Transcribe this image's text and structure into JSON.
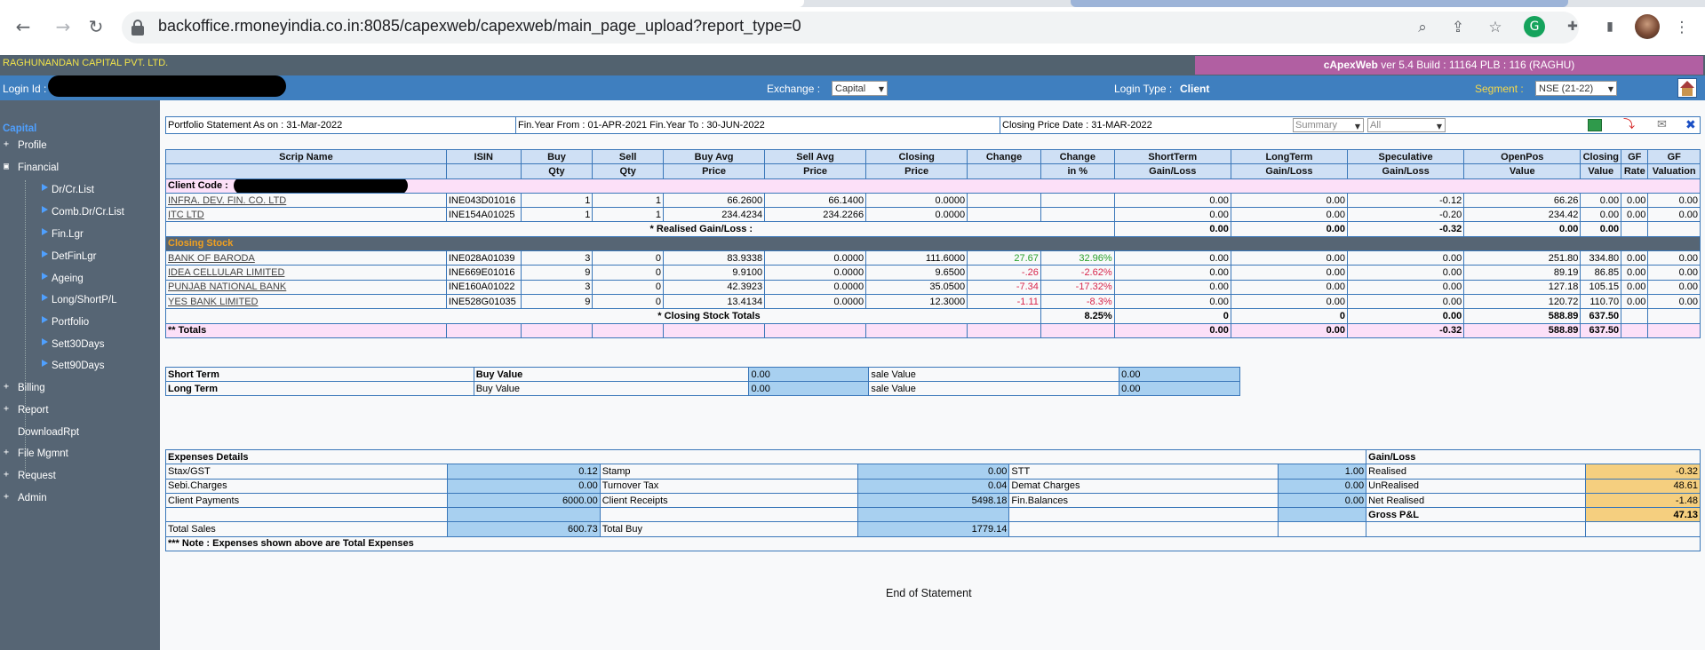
{
  "browser": {
    "url": "backoffice.rmoneyindia.co.in:8085/capexweb/capexweb/main_page_upload?report_type=0"
  },
  "header": {
    "company": "RAGHUNANDAN CAPITAL PVT. LTD.",
    "app_name": "cApexWeb",
    "version": "ver 5.4 Build : 11164  PLB : 116 (RAGHU)",
    "login_id_label": "Login Id :",
    "exchange_label": "Exchange :",
    "exchange_value": "Capital",
    "login_type_label": "Login Type :",
    "login_type_value": "Client",
    "segment_label": "Segment :",
    "segment_value": "NSE (21-22)"
  },
  "sidebar": {
    "capital": "Capital",
    "profile": "Profile",
    "financial": "Financial",
    "sub": [
      "Dr/Cr.List",
      "Comb.Dr/Cr.List",
      "Fin.Lgr",
      "DetFinLgr",
      "Ageing",
      "Long/ShortP/L",
      "Portfolio",
      "Sett30Days",
      "Sett90Days"
    ],
    "billing": "Billing",
    "report": "Report",
    "downloadrpt": "DownloadRpt",
    "filemgmt": "File Mgmnt",
    "request": "Request",
    "admin": "Admin"
  },
  "report_header": {
    "statement": "Portfolio Statement As on : 31-Mar-2022",
    "finyear": "Fin.Year From : 01-APR-2021  Fin.Year To : 30-JUN-2022",
    "closing_date": "Closing Price Date : 31-MAR-2022",
    "view_select": "Summary",
    "filter_select": "All"
  },
  "table": {
    "headers_top": [
      "Scrip Name",
      "ISIN",
      "Buy",
      "Sell",
      "Buy Avg",
      "Sell Avg",
      "Closing",
      "Change",
      "Change",
      "ShortTerm",
      "LongTerm",
      "Speculative",
      "OpenPos",
      "Closing",
      "GF",
      "GF"
    ],
    "headers_bottom": [
      "",
      "",
      "Qty",
      "Qty",
      "Price",
      "Price",
      "Price",
      "",
      "in %",
      "Gain/Loss",
      "Gain/Loss",
      "Gain/Loss",
      "Value",
      "Value",
      "Rate",
      "Valuation"
    ],
    "client_code_label": "Client Code :",
    "realised_rows": [
      [
        "INFRA. DEV. FIN. CO. LTD",
        "INE043D01016",
        "1",
        "1",
        "66.2600",
        "66.1400",
        "0.0000",
        "",
        "",
        "0.00",
        "0.00",
        "-0.12",
        "66.26",
        "0.00",
        "0.00",
        "0.00"
      ],
      [
        "ITC LTD",
        "INE154A01025",
        "1",
        "1",
        "234.4234",
        "234.2266",
        "0.0000",
        "",
        "",
        "0.00",
        "0.00",
        "-0.20",
        "234.42",
        "0.00",
        "0.00",
        "0.00"
      ]
    ],
    "realised_label": "* Realised Gain/Loss :",
    "realised_totals": [
      "0.00",
      "0.00",
      "-0.32",
      "0.00",
      "0.00"
    ],
    "closing_stock_label": "Closing Stock",
    "closing_rows": [
      [
        "BANK OF BARODA",
        "INE028A01039",
        "3",
        "0",
        "83.9338",
        "0.0000",
        "111.6000",
        "27.67",
        "32.96%",
        "0.00",
        "0.00",
        "0.00",
        "251.80",
        "334.80",
        "0.00",
        "0.00"
      ],
      [
        "IDEA CELLULAR LIMITED",
        "INE669E01016",
        "9",
        "0",
        "9.9100",
        "0.0000",
        "9.6500",
        "-.26",
        "-2.62%",
        "0.00",
        "0.00",
        "0.00",
        "89.19",
        "86.85",
        "0.00",
        "0.00"
      ],
      [
        "PUNJAB NATIONAL BANK",
        "INE160A01022",
        "3",
        "0",
        "42.3923",
        "0.0000",
        "35.0500",
        "-7.34",
        "-17.32%",
        "0.00",
        "0.00",
        "0.00",
        "127.18",
        "105.15",
        "0.00",
        "0.00"
      ],
      [
        "YES BANK LIMITED",
        "INE528G01035",
        "9",
        "0",
        "13.4134",
        "0.0000",
        "12.3000",
        "-1.11",
        "-8.3%",
        "0.00",
        "0.00",
        "0.00",
        "120.72",
        "110.70",
        "0.00",
        "0.00"
      ]
    ],
    "closing_totals_label": "* Closing Stock Totals",
    "closing_totals": [
      "8.25%",
      "0",
      "0",
      "0.00",
      "588.89",
      "637.50"
    ],
    "grand_label": "** Totals",
    "grand_totals": [
      "0.00",
      "0.00",
      "-0.32",
      "588.89",
      "637.50"
    ]
  },
  "terms": {
    "short_term": "Short Term",
    "long_term": "Long Term",
    "buy_value_bold": "Buy Value",
    "buy_value": "Buy Value",
    "sale_value": "sale Value",
    "st_buy": "0.00",
    "st_sale": "0.00",
    "lt_buy": "0.00",
    "lt_sale": "0.00"
  },
  "expenses": {
    "title": "Expenses Details",
    "gain_loss_title": "Gain/Loss",
    "rows": [
      [
        "Stax/GST",
        "0.12",
        "Stamp",
        "0.00",
        "STT",
        "1.00",
        "Realised",
        "-0.32"
      ],
      [
        "Sebi.Charges",
        "0.00",
        "Turnover Tax",
        "0.04",
        "Demat Charges",
        "0.00",
        "UnRealised",
        "48.61"
      ],
      [
        "Client Payments",
        "6000.00",
        "Client Receipts",
        "5498.18",
        "Fin.Balances",
        "0.00",
        "Net Realised",
        "-1.48"
      ]
    ],
    "gross_label": "Gross P&L",
    "gross_value": "47.13",
    "total_sales_label": "Total Sales",
    "total_sales": "600.73",
    "total_buy_label": "Total Buy",
    "total_buy": "1779.14",
    "note": "*** Note : Expenses shown above are Total Expenses"
  },
  "footer": {
    "end": "End of Statement"
  }
}
